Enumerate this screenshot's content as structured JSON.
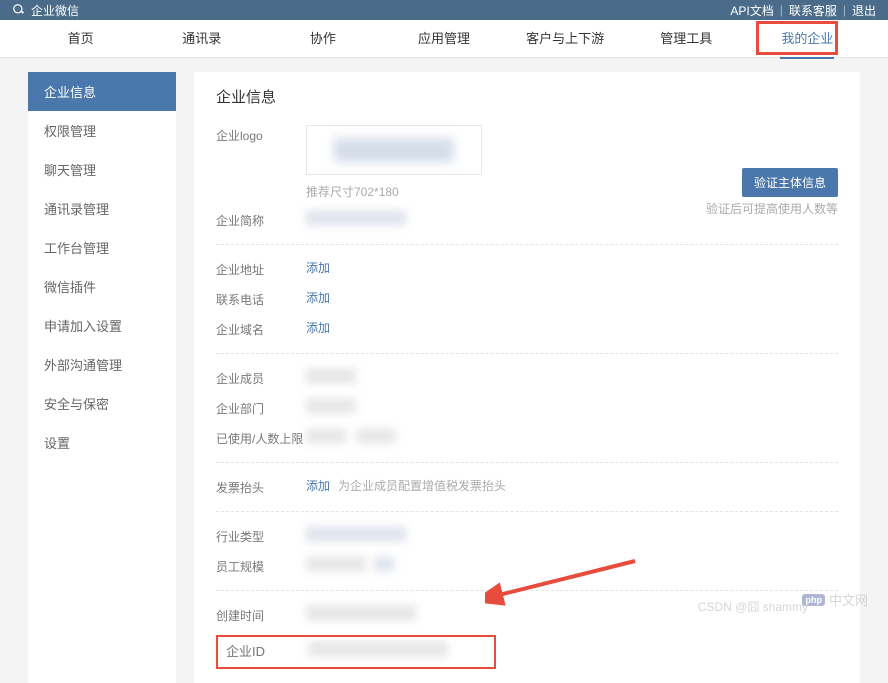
{
  "topbar": {
    "brand": "企业微信",
    "links": {
      "api": "API文档",
      "support": "联系客服",
      "logout": "退出"
    }
  },
  "nav": {
    "items": [
      "首页",
      "通讯录",
      "协作",
      "应用管理",
      "客户与上下游",
      "管理工具",
      "我的企业"
    ],
    "active_index": 6
  },
  "sidebar": {
    "items": [
      "企业信息",
      "权限管理",
      "聊天管理",
      "通讯录管理",
      "工作台管理",
      "微信插件",
      "申请加入设置",
      "外部沟通管理",
      "安全与保密",
      "设置"
    ],
    "active_index": 0
  },
  "content": {
    "title": "企业信息",
    "logo": {
      "label": "企业logo",
      "hint": "推荐尺寸702*180"
    },
    "short_name": {
      "label": "企业简称"
    },
    "verify_btn": "验证主体信息",
    "verify_hint": "验证后可提高使用人数等",
    "address": {
      "label": "企业地址",
      "action": "添加"
    },
    "phone": {
      "label": "联系电话",
      "action": "添加"
    },
    "domain": {
      "label": "企业域名",
      "action": "添加"
    },
    "members": {
      "label": "企业成员"
    },
    "depts": {
      "label": "企业部门"
    },
    "usage": {
      "label": "已使用/人数上限"
    },
    "invoice": {
      "label": "发票抬头",
      "action": "添加",
      "hint": "为企业成员配置增值税发票抬头"
    },
    "industry": {
      "label": "行业类型"
    },
    "scale": {
      "label": "员工规模"
    },
    "created": {
      "label": "创建时间"
    },
    "corp_id": {
      "label": "企业ID"
    }
  },
  "watermark": {
    "csdn": "CSDN @囧 shammy",
    "php": "中文网",
    "php_badge": "php"
  }
}
